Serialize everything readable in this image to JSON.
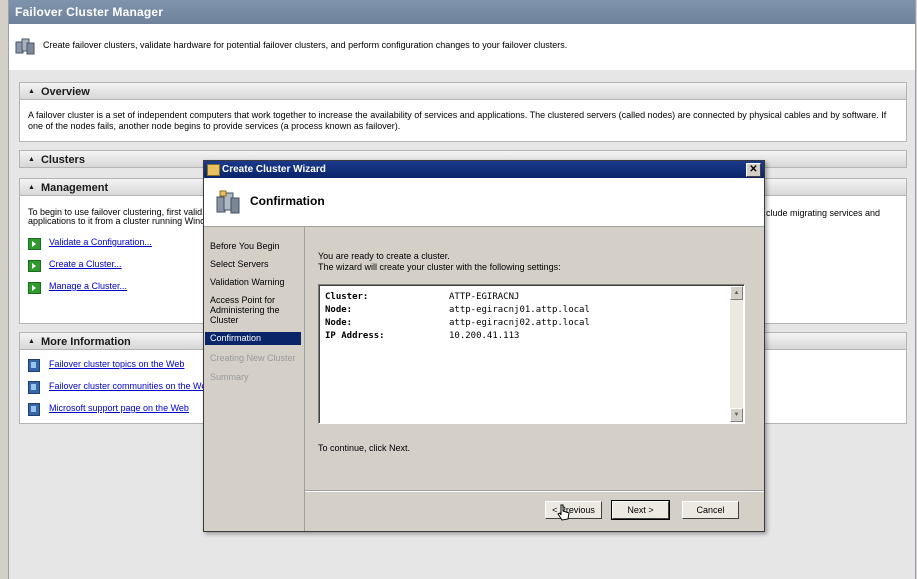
{
  "app": {
    "title": "Failover Cluster Manager",
    "description": "Create failover clusters, validate hardware for potential failover clusters, and perform configuration changes to your failover clusters."
  },
  "sections": {
    "overview": {
      "title": "Overview",
      "text": "A failover cluster is a set of independent computers that work together to increase the availability of services and applications. The clustered servers (called nodes) are connected by physical cables and by software. If one of the nodes fails, another node begins to provide services (a process known as failover)."
    },
    "clusters": {
      "title": "Clusters"
    },
    "management": {
      "title": "Management",
      "text_left_line1": "To begin to use failover clustering, first valid",
      "text_left_line2": "applications to it from a cluster running Winc",
      "text_right": "clude migrating services and",
      "links": [
        "Validate a Configuration...",
        "Create a Cluster...",
        "Manage a Cluster..."
      ]
    },
    "more_info": {
      "title": "More Information",
      "links": [
        "Failover cluster topics on the Web",
        "Failover cluster communities on the We",
        "Microsoft support page on the Web"
      ]
    }
  },
  "wizard": {
    "title": "Create Cluster Wizard",
    "close": "✕",
    "page_title": "Confirmation",
    "steps": [
      {
        "label": "Before You Begin",
        "state": "normal"
      },
      {
        "label": "Select Servers",
        "state": "normal"
      },
      {
        "label": "Validation Warning",
        "state": "normal"
      },
      {
        "label": "Access Point for Administering the Cluster",
        "state": "normal"
      },
      {
        "label": "Confirmation",
        "state": "active"
      },
      {
        "label": "Creating New Cluster",
        "state": "disabled"
      },
      {
        "label": "Summary",
        "state": "disabled"
      }
    ],
    "ready_line1": "You are ready to create a cluster.",
    "ready_line2": "The wizard will create your cluster with the following settings:",
    "settings": [
      {
        "key": "Cluster:",
        "value": "ATTP-EGIRACNJ"
      },
      {
        "key": "Node:",
        "value": "attp-egiracnj01.attp.local"
      },
      {
        "key": "Node:",
        "value": "attp-egiracnj02.attp.local"
      },
      {
        "key": "IP Address:",
        "value": "10.200.41.113"
      }
    ],
    "continue_text": "To continue, click Next.",
    "buttons": {
      "previous": "< Previous",
      "next": "Next >",
      "cancel": "Cancel"
    }
  }
}
